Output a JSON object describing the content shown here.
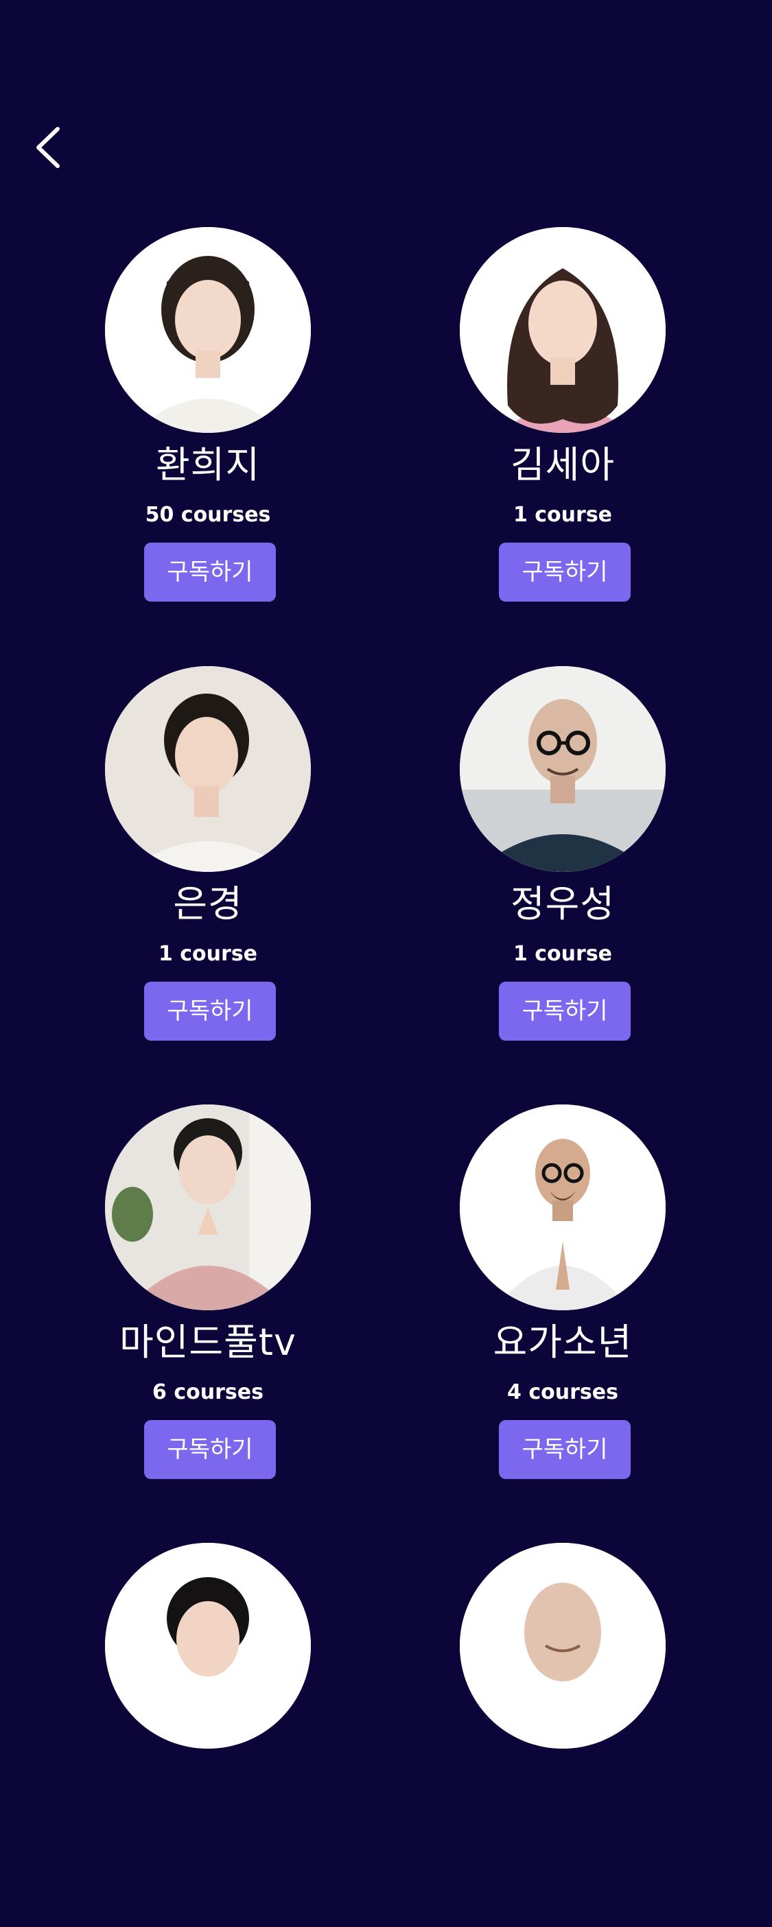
{
  "nav": {
    "back_icon": "chevron-left-icon"
  },
  "subscribe_label": "구독하기",
  "instructors": [
    {
      "name": "환희지",
      "courses": "50 courses",
      "bg": "#ffffff",
      "hair": "#2b211c",
      "shirt": "#f2f0ea"
    },
    {
      "name": "김세아",
      "courses": "1 course",
      "bg": "#ffffff",
      "hair": "#3a2620",
      "shirt": "#e9a3b6"
    },
    {
      "name": "은경",
      "courses": "1 course",
      "bg": "#e9e4dd",
      "hair": "#1f1915",
      "shirt": "#f5f3ef"
    },
    {
      "name": "정우성",
      "courses": "1 course",
      "bg": "#f0f0ef",
      "hair": "#d9b8a4",
      "shirt": "#1f3344"
    },
    {
      "name": "마인드풀tv",
      "courses": "6 courses",
      "bg": "#e8e4df",
      "hair": "#1d1b1a",
      "shirt": "#d8a9a6"
    },
    {
      "name": "요가소년",
      "courses": "4 courses",
      "bg": "#ffffff",
      "hair": "#d4ab8f",
      "shirt": "#ececec"
    },
    {
      "name": "",
      "courses": "",
      "bg": "#ffffff",
      "hair": "#141212",
      "shirt": "#f3f3f3"
    },
    {
      "name": "",
      "courses": "",
      "bg": "#ffffff",
      "hair": "#e2c3b0",
      "shirt": "#ececec"
    }
  ]
}
